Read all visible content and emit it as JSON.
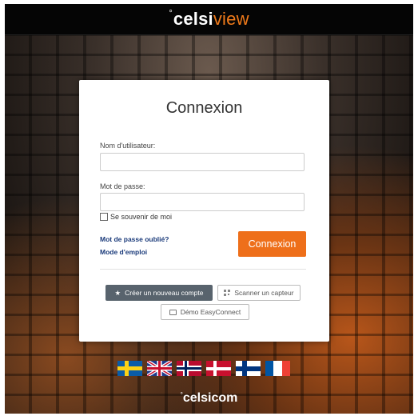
{
  "header": {
    "logo_prefix": "°",
    "logo_bold": "celsi",
    "logo_light": "view"
  },
  "login": {
    "title": "Connexion",
    "username_label": "Nom d'utilisateur:",
    "username_value": "",
    "password_label": "Mot de passe:",
    "password_value": "",
    "remember_label": "Se souvenir de moi",
    "forgot_link": "Mot de passe oublié?",
    "manual_link": "Mode d'emploi",
    "submit_label": "Connexion"
  },
  "actions": {
    "create_account": "Créer un nouveau compte",
    "scan_sensor": "Scanner un capteur",
    "demo": "Démo EasyConnect"
  },
  "languages": [
    "Swedish",
    "English",
    "Norwegian",
    "Danish",
    "Finnish",
    "French"
  ],
  "footer": {
    "logo_prefix": "°",
    "logo_text": "celsicom"
  },
  "colors": {
    "accent": "#ee6f1a",
    "dark_button": "#58636d",
    "link": "#1a3a7a"
  }
}
